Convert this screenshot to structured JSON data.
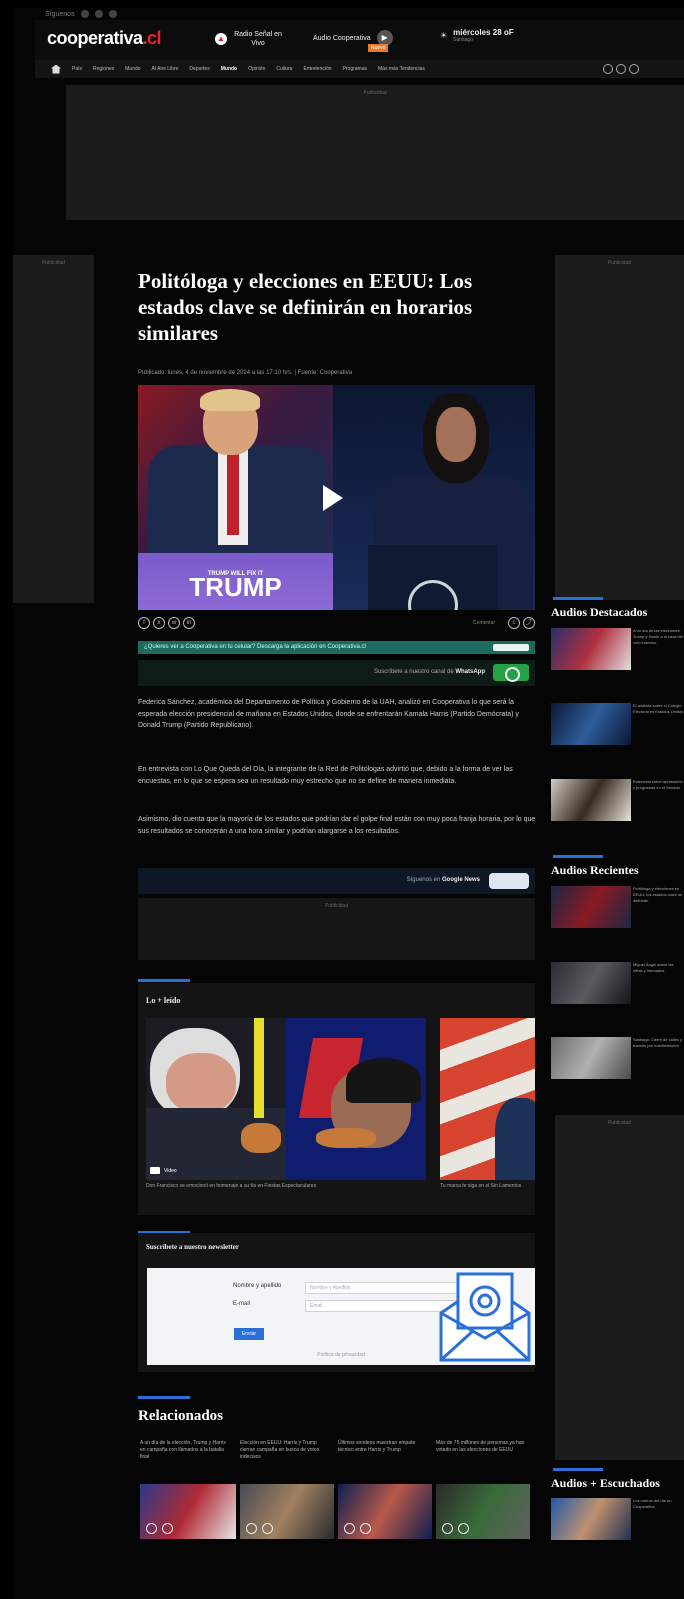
{
  "topline": {
    "label": "Síguenos"
  },
  "header": {
    "logo_main": "cooperativa",
    "logo_suffix": ".cl",
    "radio_label": "Radio Señal en Vivo",
    "audio_label": "Audio Cooperativa",
    "audio_badge": "Nuevo",
    "weather_temp": "miércoles 28 oF",
    "weather_sub": "Santiago"
  },
  "nav": {
    "items": [
      "País",
      "Regiones",
      "Mundo",
      "Al Aire Libre",
      "Deportes",
      "Mundo",
      "Opinión",
      "Cultura",
      "Entretención",
      "Programas",
      "Más más Tendencias"
    ]
  },
  "ads": {
    "label": "Publicidad"
  },
  "article": {
    "title": "Politóloga y elecciones en EEUU: Los estados clave se definirán en horarios similares",
    "byline": "Publicado: lunes, 4 de noviembre de 2024 a las 17:10 hrs. | Fuente: Cooperativa",
    "hero_sign": "TRUMP",
    "hero_sign_top": "TRUMP WILL FIX IT",
    "share_label": "Comentar",
    "green_bar_text": "¿Quieres ver a Cooperativa en tu celular? Descarga la aplicación en Cooperativa.cl",
    "whatsapp_text": "Suscríbete a nuestro canal de",
    "whatsapp_brand": "WhatsApp",
    "p1": "Federica Sánchez, académica del Departamento de Política y Gobierno de la UAH, analizó en Cooperativa lo que será la esperada elección presidencial de mañana en Estados Unidos, donde se enfrentarán Kamala Harris (Partido Demócrata) y Donald Trump (Partido Republicano).",
    "p2": "En entrevista con Lo Que Queda del Día, la integrante de la Red de Politólogas advirtió que, debido a la forma de ver las encuestas, en lo que se espera sea un resultado muy estrecho que no se define de manera inmediata.",
    "p3": "Asimismo, dio cuenta que la mayoría de los estados que podrían dar el golpe final están con muy poca franja horaria, por lo que sus resultados se conocerán a una hora similar y podrían alargarse a los resultados.",
    "gnews_text": "Síguenos en",
    "gnews_brand": "Google News"
  },
  "lo_leido": {
    "title": "Lo + leído",
    "cap1": "Don Francisco se emocionó en homenaje a su tía en Fiestas Espectaculares",
    "cap2": "Tu marca te siga en el Sin Lamentos",
    "badge": "Video"
  },
  "newsletter": {
    "title": "Suscríbete a nuestro newsletter",
    "name_label": "Nombre y apellido",
    "name_placeholder": "Nombre y Apellido",
    "email_label": "E-mail",
    "email_placeholder": "Email",
    "send": "Enviar",
    "footer": "Política de privacidad"
  },
  "relacionados": {
    "title": "Relacionados",
    "items": [
      "A un día de la elección, Trump y Harris en campaña con llamados a la batalla final",
      "Elección en EEUU: Harris y Trump cierran campaña en busca de votos indecisos",
      "Últimos sondeos muestran empate técnico entre Harris y Trump",
      "Más de 75 millones de personas ya han votado en las elecciones de EEUU"
    ]
  },
  "right": {
    "destacados_title": "Audios Destacados",
    "recientes_title": "Audios Recientes",
    "escuchados_title": "Audios + Escuchados",
    "destacados": [
      "A un día de las elecciones: Trump y Harris a la caza del voto indeciso",
      "El analista sobre el Colegio Electoral en Estados Unidos",
      "Entrevista sobre aprobación y programas en el Senado"
    ],
    "recientes": [
      "Politóloga y elecciones en EEUU: los estados clave se definirán",
      "Miguel Ángel sobre las cifras y mercados",
      "Santiago: Cierre de calles y tránsito por manifestación"
    ],
    "escuchados": [
      "Los rostros del día en Cooperativa"
    ]
  }
}
